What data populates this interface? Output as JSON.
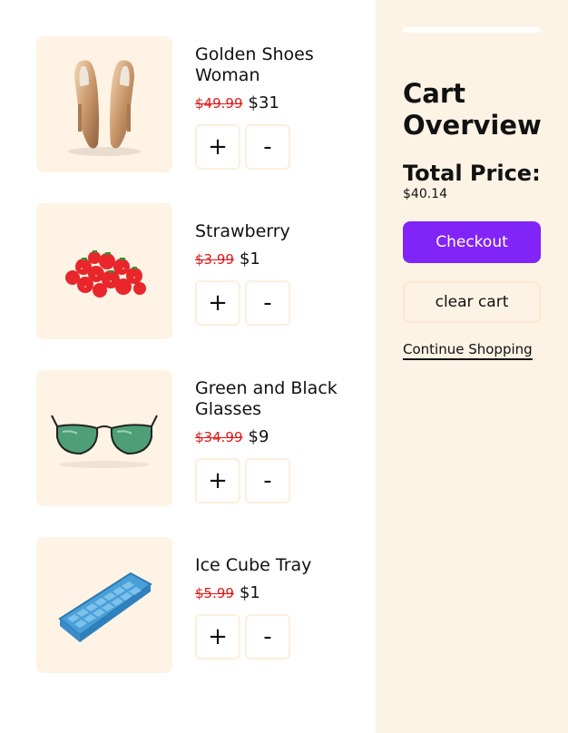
{
  "cart": {
    "items": [
      {
        "name": "Golden Shoes Woman",
        "old_price": "$49.99",
        "price": "$31",
        "plus": "+",
        "minus": "-",
        "image": "gold-heels-image"
      },
      {
        "name": "Strawberry",
        "old_price": "$3.99",
        "price": "$1",
        "plus": "+",
        "minus": "-",
        "image": "strawberries-image"
      },
      {
        "name": "Green and Black Glasses",
        "old_price": "$34.99",
        "price": "$9",
        "plus": "+",
        "minus": "-",
        "image": "sunglasses-image"
      },
      {
        "name": "Ice Cube Tray",
        "old_price": "$5.99",
        "price": "$1",
        "plus": "+",
        "minus": "-",
        "image": "ice-cube-tray-image"
      }
    ]
  },
  "summary": {
    "title": "Cart Overview",
    "total_label": "Total Price:",
    "total_value": "$40.14",
    "checkout_label": "Checkout",
    "clear_label": "clear cart",
    "continue_label": "Continue Shopping"
  },
  "colors": {
    "accent": "#8124f7",
    "strike_price": "#e0191b",
    "panel_bg": "#fdf3e5",
    "thumb_bg": "#fef3e4"
  }
}
